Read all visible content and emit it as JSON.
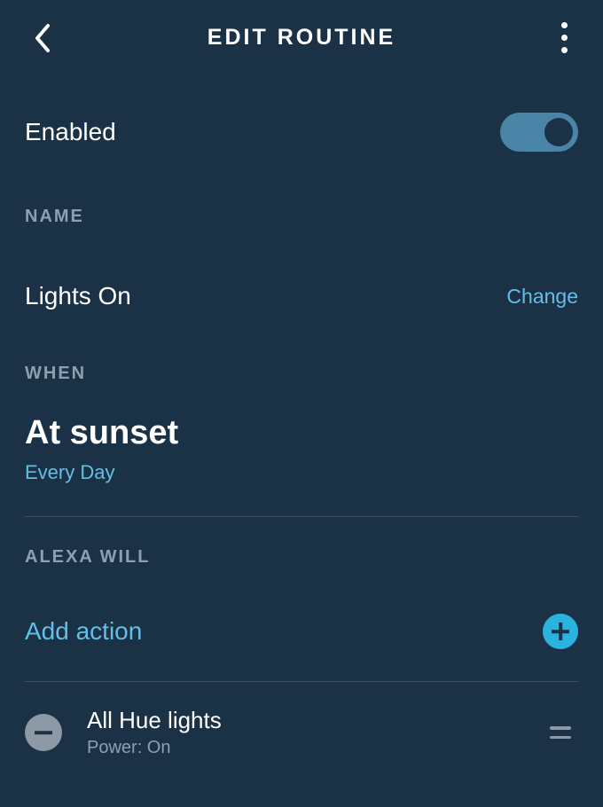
{
  "header": {
    "title": "EDIT ROUTINE"
  },
  "enabled": {
    "label": "Enabled",
    "value": true
  },
  "sections": {
    "name_label": "NAME",
    "when_label": "WHEN",
    "alexa_label": "ALEXA WILL"
  },
  "name": {
    "value": "Lights On",
    "change_label": "Change"
  },
  "when": {
    "title": "At sunset",
    "subtitle": "Every Day"
  },
  "add_action": {
    "label": "Add action"
  },
  "actions": [
    {
      "title": "All Hue lights",
      "subtitle": "Power: On"
    }
  ],
  "colors": {
    "background": "#1a3146",
    "accent": "#63bfe6",
    "muted": "#8ea0af",
    "toggle_on": "#4a85a7",
    "plus_bg": "#2bb3df",
    "minus_bg": "#8d9aa6"
  }
}
